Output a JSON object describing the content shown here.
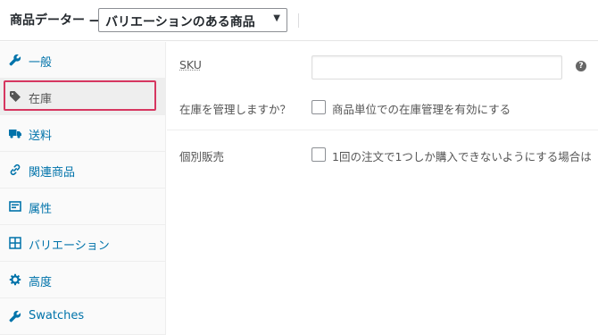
{
  "header": {
    "title": "商品データー —",
    "product_type_value": "バリエーションのある商品",
    "select_arrow": "▼"
  },
  "sidebar": {
    "tabs": [
      {
        "label": "一般",
        "icon": "wrench-icon"
      },
      {
        "label": "在庫",
        "icon": "tag-icon",
        "active": true
      },
      {
        "label": "送料",
        "icon": "truck-icon"
      },
      {
        "label": "関連商品",
        "icon": "link-icon"
      },
      {
        "label": "属性",
        "icon": "table-icon"
      },
      {
        "label": "バリエーション",
        "icon": "grid-icon"
      },
      {
        "label": "高度",
        "icon": "gear-icon"
      },
      {
        "label": "Swatches",
        "icon": "wrench-icon"
      }
    ]
  },
  "inventory": {
    "sku_label": "SKU",
    "sku_value": "",
    "help_symbol": "?",
    "manage_stock_label": "在庫を管理しますか？",
    "manage_stock_desc": "商品単位での在庫管理を有効にする",
    "sold_individually_label": "個別販売",
    "sold_individually_desc": "1回の注文で1つしか購入できないようにする場合は"
  },
  "colors": {
    "link": "#0073aa",
    "highlight": "#d63660",
    "active_tab_bg": "#eeeeee"
  }
}
